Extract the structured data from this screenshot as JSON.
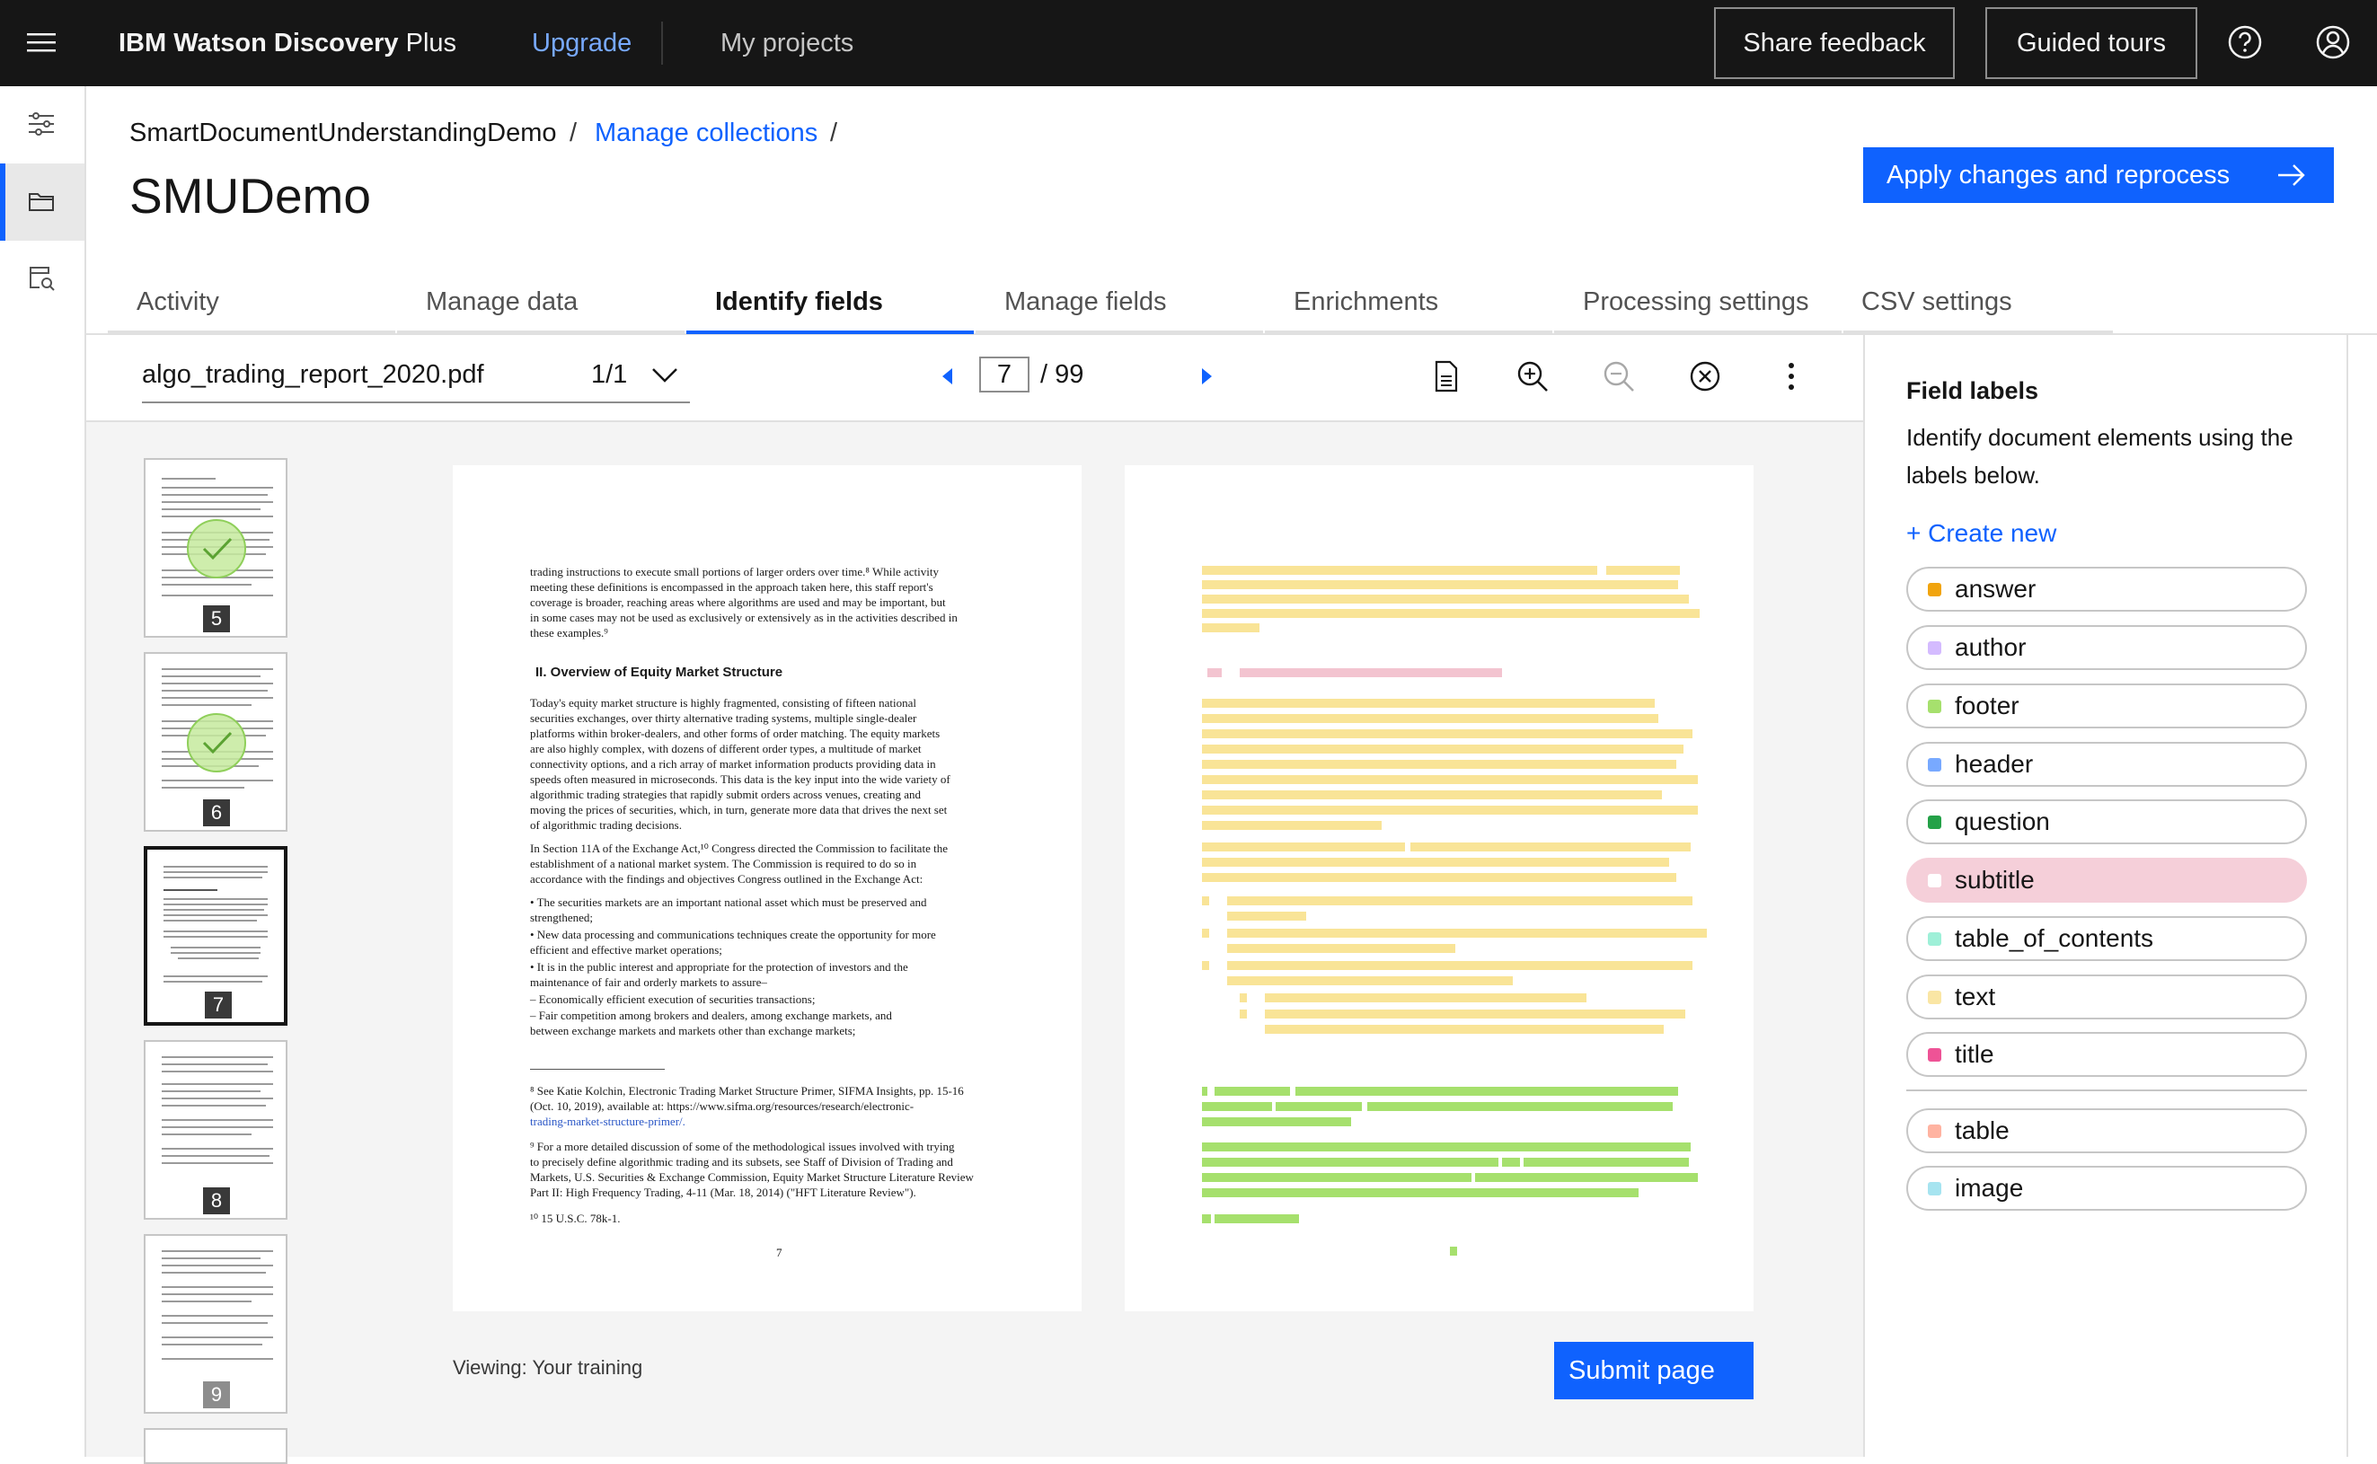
{
  "topbar": {
    "brand_strong": "IBM Watson Discovery",
    "brand_rest": " Plus",
    "upgrade": "Upgrade",
    "my_projects": "My projects",
    "share_feedback": "Share feedback",
    "guided_tours": "Guided tours"
  },
  "breadcrumb": {
    "project": "SmartDocumentUnderstandingDemo",
    "sep1": "/",
    "manage_collections": "Manage collections",
    "sep2": "/"
  },
  "page_title": "SMUDemo",
  "apply_button": "Apply changes and reprocess",
  "tabs": [
    {
      "label": "Activity"
    },
    {
      "label": "Manage data"
    },
    {
      "label": "Identify fields"
    },
    {
      "label": "Manage fields"
    },
    {
      "label": "Enrichments"
    },
    {
      "label": "Processing settings"
    },
    {
      "label": "CSV settings"
    }
  ],
  "toolbar": {
    "file_name": "algo_trading_report_2020.pdf",
    "file_count": "1/1",
    "current_page": "7",
    "total_pages": "/ 99"
  },
  "thumbnails": [
    {
      "num": "5",
      "done": true
    },
    {
      "num": "6",
      "done": true
    },
    {
      "num": "7",
      "done": false
    },
    {
      "num": "8",
      "done": false
    },
    {
      "num": "9",
      "done": false
    }
  ],
  "document": {
    "lines_top": [
      "trading instructions to execute small portions of larger orders over time.⁸ While activity",
      "meeting these definitions is encompassed in the approach taken here, this staff report's",
      "coverage is broader, reaching areas where algorithms are used and may be important, but",
      "in some cases may not be used as exclusively or extensively as in the activities described in",
      "these examples.⁹"
    ],
    "heading": "II.     Overview of Equity Market Structure",
    "para1": [
      "Today's equity market structure is highly fragmented, consisting of fifteen national",
      "securities exchanges, over thirty alternative trading systems, multiple single-dealer",
      "platforms within broker-dealers, and other forms of order matching.  The equity markets",
      "are also highly complex, with dozens of different order types, a multitude of market",
      "connectivity options, and a rich array of market information products providing data in",
      "speeds often measured in microseconds.  This data is the key input into the wide variety of",
      "algorithmic trading strategies that rapidly submit orders across venues, creating and",
      "moving the prices of securities, which, in turn, generate more data that drives the next set",
      "of algorithmic trading decisions."
    ],
    "para2": [
      "In Section 11A of the Exchange Act,¹⁰ Congress directed the Commission to facilitate the",
      "establishment of a national market system.  The Commission is required to do so in",
      "accordance with the findings and objectives Congress outlined in the Exchange Act:"
    ],
    "bullets": [
      "•   The securities markets are an important national asset which must be preserved and",
      "     strengthened;",
      "•   New data processing and communications techniques create the opportunity for more",
      "     efficient and effective market operations;",
      "•   It is in the public interest and appropriate for the protection of investors and the",
      "     maintenance of fair and orderly markets to assure–",
      "          –     Economically efficient execution of securities transactions;",
      "          –     Fair competition among brokers and dealers, among exchange markets, and",
      "                 between exchange markets and markets other than exchange markets;"
    ],
    "footnotes": [
      "⁸ See Katie Kolchin, Electronic Trading Market Structure Primer, SIFMA Insights, pp. 15-16",
      "(Oct. 10, 2019), available at: https://www.sifma.org/resources/research/electronic-",
      "trading-market-structure-primer/.",
      "",
      "⁹ For a more detailed discussion of some of the methodological issues involved with trying",
      "to precisely define algorithmic trading and its subsets, see Staff of Division of Trading and",
      "Markets, U.S. Securities & Exchange Commission, Equity Market Structure Literature Review",
      "Part II: High Frequency Trading, 4-11 (Mar. 18, 2014) (\"HFT Literature Review\").",
      "",
      "¹⁰ 15 U.S.C. 78k-1."
    ],
    "page_number": "7"
  },
  "viewing_text": "Viewing: Your training",
  "submit_button": "Submit page",
  "panel": {
    "title": "Field labels",
    "description": "Identify document elements using the labels below.",
    "create_new": "+ Create new",
    "labels": [
      {
        "name": "answer",
        "color": "#f1a40e"
      },
      {
        "name": "author",
        "color": "#d4bbff"
      },
      {
        "name": "footer",
        "color": "#a6e06d"
      },
      {
        "name": "header",
        "color": "#78a9ff"
      },
      {
        "name": "question",
        "color": "#24a148"
      },
      {
        "name": "subtitle",
        "color": "#ffd6e8"
      },
      {
        "name": "table_of_contents",
        "color": "#9ef0d8"
      },
      {
        "name": "text",
        "color": "#fae6a4"
      },
      {
        "name": "title",
        "color": "#ee5396"
      }
    ],
    "extra_labels": [
      {
        "name": "table",
        "color": "#ffb3a1"
      },
      {
        "name": "image",
        "color": "#a6e4f0"
      }
    ]
  }
}
